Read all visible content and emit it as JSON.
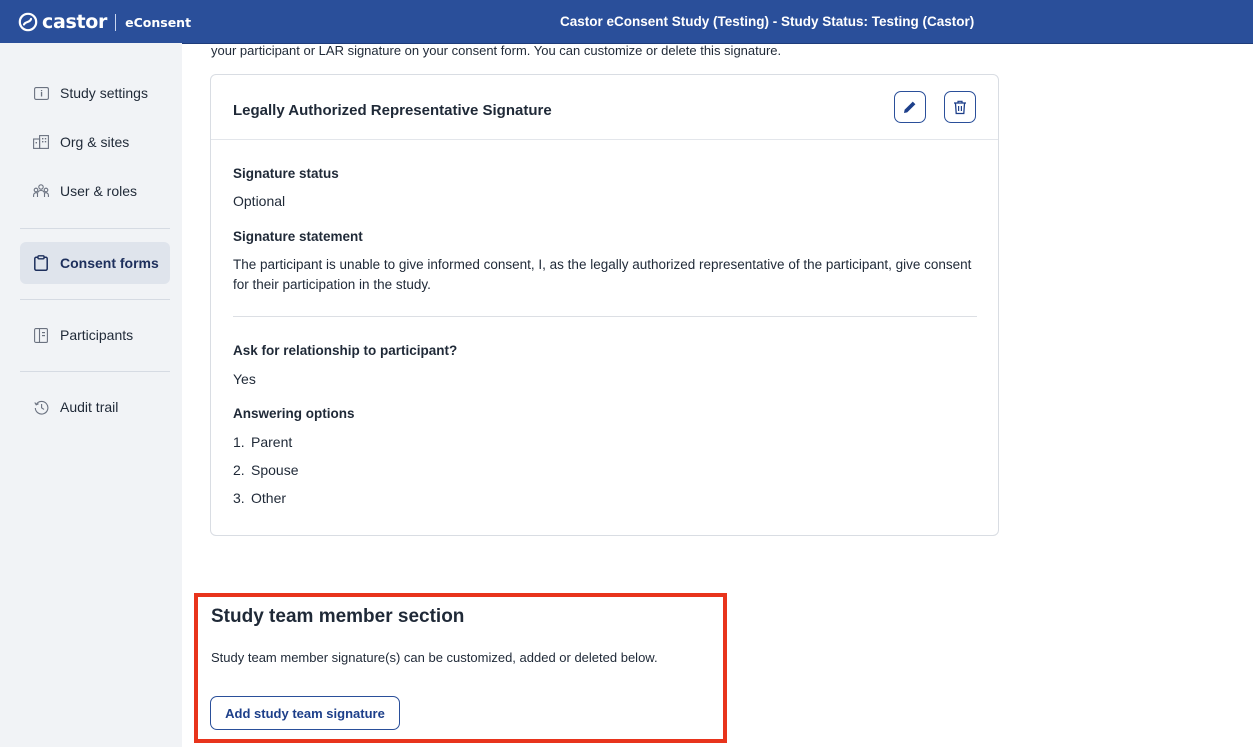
{
  "header": {
    "logo_text": "castor",
    "logo_sub": "eConsent",
    "title": "Castor eConsent Study (Testing)  - Study Status: Testing (Castor)"
  },
  "sidebar": {
    "items": [
      {
        "label": "Study settings",
        "icon": "info-box-icon"
      },
      {
        "label": "Org & sites",
        "icon": "building-icon"
      },
      {
        "label": "User & roles",
        "icon": "users-icon"
      },
      {
        "label": "Consent forms",
        "icon": "clipboard-icon",
        "active": true
      },
      {
        "label": "Participants",
        "icon": "id-card-icon"
      },
      {
        "label": "Audit trail",
        "icon": "history-icon"
      }
    ]
  },
  "main": {
    "intro_text": "your participant or LAR signature on your consent form. You can customize or delete this signature.",
    "card": {
      "title": "Legally Authorized Representative Signature",
      "edit_icon": "pencil-icon",
      "delete_icon": "trash-icon",
      "signature_status_label": "Signature status",
      "signature_status_value": "Optional",
      "signature_statement_label": "Signature statement",
      "signature_statement_value": "The participant is unable to give informed consent, I, as the legally authorized representative of the participant, give consent for their participation in the study.",
      "relationship_label": "Ask for relationship to participant?",
      "relationship_value": "Yes",
      "answering_options_label": "Answering options",
      "options": [
        {
          "num": "1.",
          "label": "Parent"
        },
        {
          "num": "2.",
          "label": "Spouse"
        },
        {
          "num": "3.",
          "label": "Other"
        }
      ]
    },
    "team_section": {
      "title": "Study team member section",
      "description": "Study team member signature(s) can be customized, added or deleted below.",
      "add_button_label": "Add study team signature"
    }
  },
  "colors": {
    "brand": "#2a4f9a",
    "highlight": "#e8341c",
    "sidebar_bg": "#f1f3f6"
  }
}
